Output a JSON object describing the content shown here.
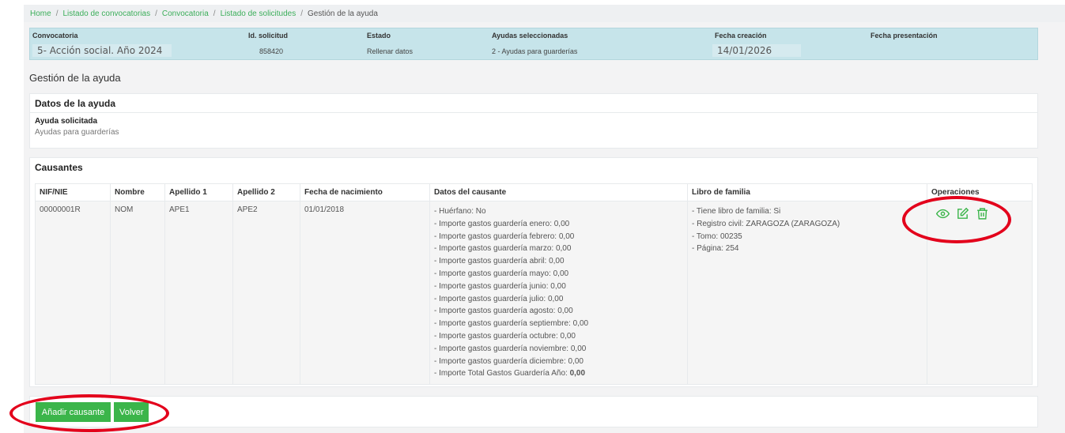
{
  "breadcrumb": {
    "items": [
      "Home",
      "Listado de convocatorias",
      "Convocatoria",
      "Listado de solicitudes"
    ],
    "separator": "/",
    "current": "Gestión de la ayuda"
  },
  "info": {
    "headers": [
      "Convocatoria",
      "Id. solicitud",
      "Estado",
      "Ayudas seleccionadas",
      "Fecha creación",
      "Fecha presentación"
    ],
    "convocatoria": "5- Acción social. Año 2024",
    "id_solicitud": "858420",
    "estado": "Rellenar datos",
    "ayudas": "2 - Ayudas para guarderías",
    "fecha_creacion": "14/01/2026",
    "fecha_presentacion": ""
  },
  "page_title": "Gestión de la ayuda",
  "datos_ayuda": {
    "title": "Datos de la ayuda",
    "label": "Ayuda solicitada",
    "value": "Ayudas para guarderías"
  },
  "causantes": {
    "title": "Causantes",
    "columns": [
      "NIF/NIE",
      "Nombre",
      "Apellido 1",
      "Apellido 2",
      "Fecha de nacimiento",
      "Datos del causante",
      "Libro de familia",
      "Operaciones"
    ],
    "row": {
      "nif": "00000001R",
      "nombre": "NOM",
      "apellido1": "APE1",
      "apellido2": "APE2",
      "fecha_nacimiento": "01/01/2018",
      "datos": [
        "- Huérfano: No",
        "- Importe gastos guardería enero: 0,00",
        "- Importe gastos guardería febrero: 0,00",
        "- Importe gastos guardería marzo: 0,00",
        "- Importe gastos guardería abril: 0,00",
        "- Importe gastos guardería mayo: 0,00",
        "- Importe gastos guardería junio: 0,00",
        "- Importe gastos guardería julio: 0,00",
        "- Importe gastos guardería agosto: 0,00",
        "- Importe gastos guardería septiembre: 0,00",
        "- Importe gastos guardería octubre: 0,00",
        "- Importe gastos guardería noviembre: 0,00",
        "- Importe gastos guardería diciembre: 0,00"
      ],
      "total_label": "- Importe Total Gastos Guardería Año: ",
      "total_value": "0,00",
      "libro": [
        "- Tiene libro de familia: Si",
        "- Registro civil: ZARAGOZA (ZARAGOZA)",
        "- Tomo: 00235",
        "- Página: 254"
      ],
      "operations": [
        "view-icon",
        "edit-icon",
        "delete-icon"
      ]
    }
  },
  "buttons": {
    "add": "Añadir causante",
    "back": "Volver"
  },
  "colors": {
    "accent": "#3bb54a",
    "info_bar": "#c6e4ea",
    "annotation": "#e3001b"
  }
}
